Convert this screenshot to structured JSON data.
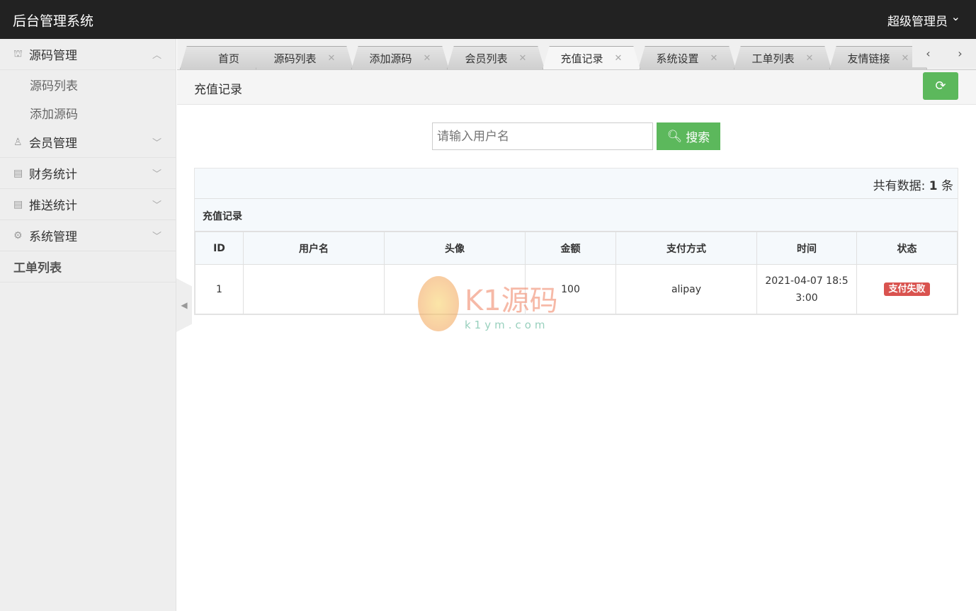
{
  "header": {
    "title": "后台管理系统",
    "user": "超级管理员"
  },
  "sidebar": {
    "groups": [
      {
        "label": "源码管理",
        "icon": "bag-icon",
        "expanded": true,
        "children": [
          "源码列表",
          "添加源码"
        ]
      },
      {
        "label": "会员管理",
        "icon": "user-icon"
      },
      {
        "label": "财务统计",
        "icon": "chart-icon"
      },
      {
        "label": "推送统计",
        "icon": "chart-icon"
      },
      {
        "label": "系统管理",
        "icon": "gear-icon"
      }
    ],
    "single": "工单列表"
  },
  "tabs": [
    "首页",
    "源码列表",
    "添加源码",
    "会员列表",
    "充值记录",
    "系统设置",
    "工单列表",
    "友情链接"
  ],
  "active_tab": "充值记录",
  "page_title": "充值记录",
  "search": {
    "placeholder": "请输入用户名",
    "button": "搜索"
  },
  "count": {
    "prefix": "共有数据:",
    "value": "1",
    "suffix": "条"
  },
  "table": {
    "caption": "充值记录",
    "headers": [
      "ID",
      "用户名",
      "头像",
      "金额",
      "支付方式",
      "时间",
      "状态"
    ],
    "rows": [
      {
        "id": "1",
        "username": "",
        "avatar": "",
        "amount": "100",
        "pay": "alipay",
        "time": "2021-04-07 18:53:00",
        "status": "支付失败"
      }
    ]
  },
  "watermark": {
    "brand": "K1源码",
    "domain": "k1ym.com"
  }
}
